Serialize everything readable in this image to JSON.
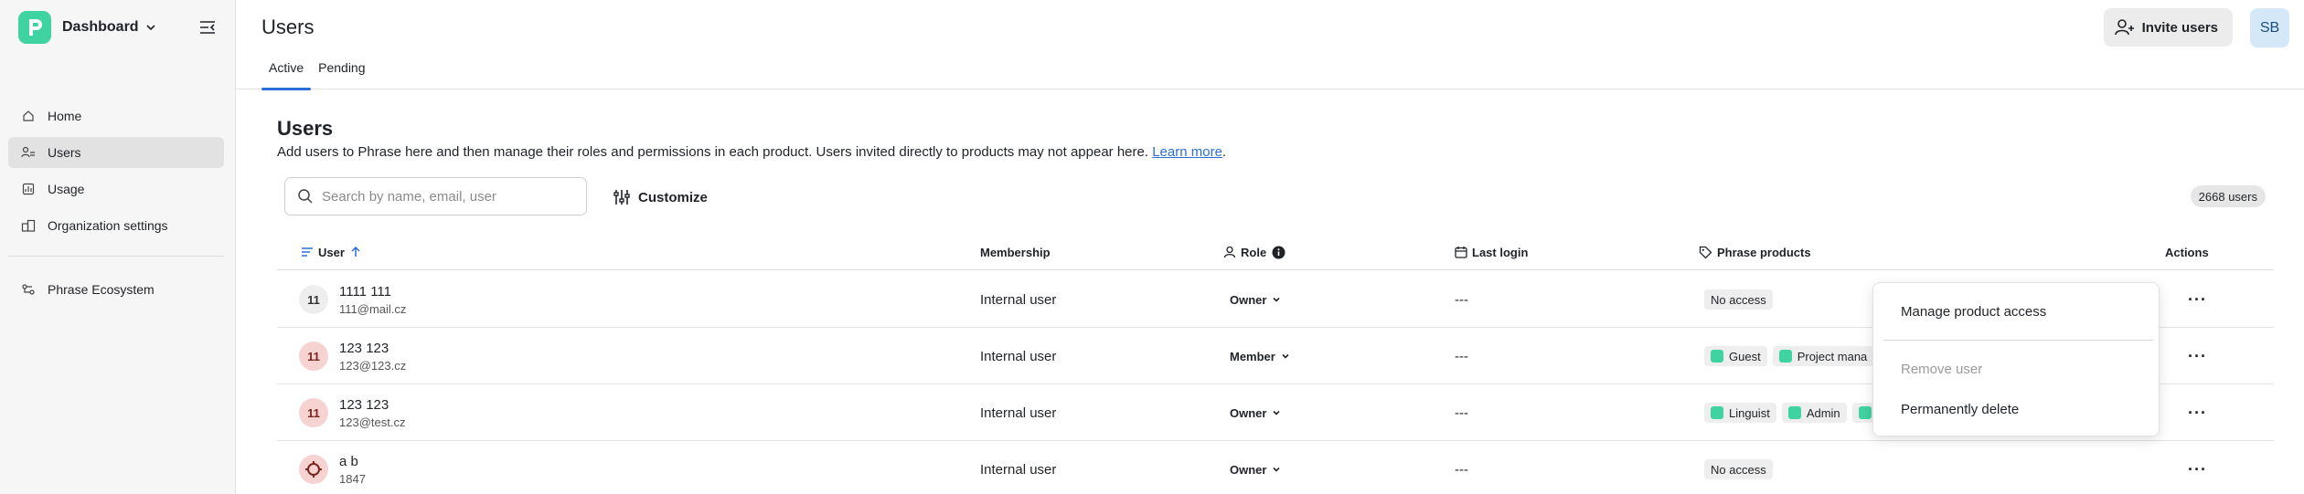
{
  "sidebar": {
    "brand": "Dashboard",
    "nav": [
      {
        "label": "Home",
        "icon": "home-icon"
      },
      {
        "label": "Users",
        "icon": "users-icon",
        "active": true
      },
      {
        "label": "Usage",
        "icon": "usage-icon"
      },
      {
        "label": "Organization settings",
        "icon": "organization-icon"
      }
    ],
    "nav2": [
      {
        "label": "Phrase Ecosystem",
        "icon": "ecosystem-icon"
      }
    ]
  },
  "header": {
    "title": "Users",
    "tabs": [
      {
        "label": "Active",
        "active": true
      },
      {
        "label": "Pending"
      }
    ],
    "invite_label": "Invite users",
    "user_initials": "SB"
  },
  "main": {
    "section_title": "Users",
    "description": "Add users to Phrase here and then manage their roles and permissions in each product. Users invited directly to products may not appear here.",
    "learn_more": "Learn more",
    "search_placeholder": "Search by name, email, user",
    "customize_label": "Customize",
    "user_count": "2668 users"
  },
  "table": {
    "columns": {
      "user": "User",
      "membership": "Membership",
      "role": "Role",
      "last_login": "Last login",
      "products": "Phrase products",
      "actions": "Actions"
    },
    "rows": [
      {
        "initials": "11",
        "avatar": "grey",
        "name": "1111 111",
        "email": "111@mail.cz",
        "membership": "Internal user",
        "role": "Owner",
        "last_login": "---",
        "products": [
          "No access"
        ]
      },
      {
        "initials": "11",
        "avatar": "pink",
        "name": "123 123",
        "email": "123@123.cz",
        "membership": "Internal user",
        "role": "Member",
        "last_login": "---",
        "products": [
          "Guest",
          "Project mana"
        ]
      },
      {
        "initials": "11",
        "avatar": "pink",
        "name": "123 123",
        "email": "123@test.cz",
        "membership": "Internal user",
        "role": "Owner",
        "last_login": "---",
        "products": [
          "Linguist",
          "Admin",
          ""
        ]
      },
      {
        "initials": "",
        "avatar": "pink",
        "name": "a b",
        "email": "1847",
        "membership": "Internal user",
        "role": "Owner",
        "last_login": "---",
        "products": [
          "No access"
        ]
      }
    ],
    "actions_glyph": "···"
  },
  "menu": {
    "manage": "Manage product access",
    "remove": "Remove user",
    "delete": "Permanently delete"
  },
  "colors": {
    "brand": "#3fd3a1",
    "accent": "#2b6fd6",
    "active_nav_bg": "#e2e2e2"
  }
}
